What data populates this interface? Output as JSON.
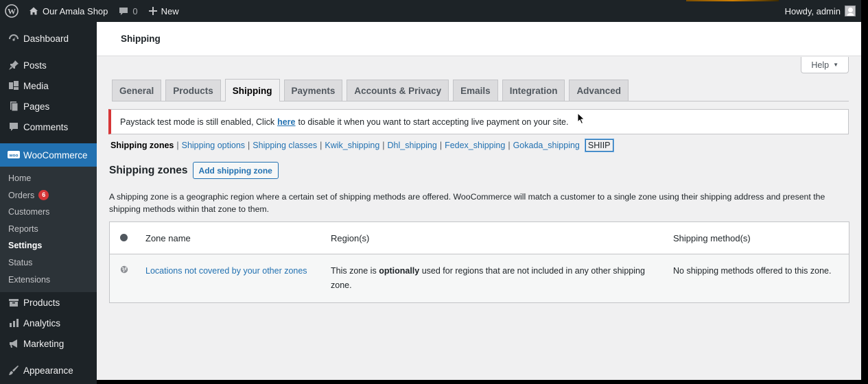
{
  "adminbar": {
    "site_name": "Our Amala Shop",
    "comments_count": "0",
    "new_label": "New",
    "howdy": "Howdy, admin"
  },
  "sidebar": {
    "items_top": [
      {
        "label": "Dashboard",
        "icon": "dashboard-icon"
      },
      {
        "label": "Posts",
        "icon": "pin-icon"
      },
      {
        "label": "Media",
        "icon": "media-icon"
      },
      {
        "label": "Pages",
        "icon": "pages-icon"
      },
      {
        "label": "Comments",
        "icon": "comment-icon"
      }
    ],
    "woocommerce": "WooCommerce",
    "woo_submenu": {
      "home": "Home",
      "orders": "Orders",
      "orders_badge": "6",
      "customers": "Customers",
      "reports": "Reports",
      "settings": "Settings",
      "status": "Status",
      "extensions": "Extensions"
    },
    "items_bottom": [
      {
        "label": "Products",
        "icon": "products-icon"
      },
      {
        "label": "Analytics",
        "icon": "analytics-icon"
      },
      {
        "label": "Marketing",
        "icon": "megaphone-icon"
      },
      {
        "label": "Appearance",
        "icon": "brush-icon"
      }
    ]
  },
  "page": {
    "title": "Shipping",
    "help": "Help"
  },
  "tabs": [
    "General",
    "Products",
    "Shipping",
    "Payments",
    "Accounts & Privacy",
    "Emails",
    "Integration",
    "Advanced"
  ],
  "active_tab": "Shipping",
  "notice": {
    "before": "Paystack test mode is still enabled, Click",
    "link": "here",
    "after": "to disable it when you want to start accepting live payment on your site."
  },
  "subsections": [
    "Shipping zones",
    "Shipping options",
    "Shipping classes",
    "Kwik_shipping",
    "Dhl_shipping",
    "Fedex_shipping",
    "Gokada_shipping",
    "SHIIP"
  ],
  "heading": {
    "title": "Shipping zones",
    "add_button": "Add shipping zone"
  },
  "description": "A shipping zone is a geographic region where a certain set of shipping methods are offered. WooCommerce will match a customer to a single zone using their shipping address and present the shipping methods within that zone to them.",
  "table": {
    "headers": {
      "zone_name": "Zone name",
      "regions": "Region(s)",
      "methods": "Shipping method(s)"
    },
    "row": {
      "zone_name": "Locations not covered by your other zones",
      "regions_before": "This zone is",
      "regions_bold": "optionally",
      "regions_after": "used for regions that are not included in any other shipping zone.",
      "methods": "No shipping methods offered to this zone."
    }
  },
  "colors": {
    "accent": "#2271b1",
    "admin_dark": "#1d2327",
    "notice_error": "#d63638"
  }
}
